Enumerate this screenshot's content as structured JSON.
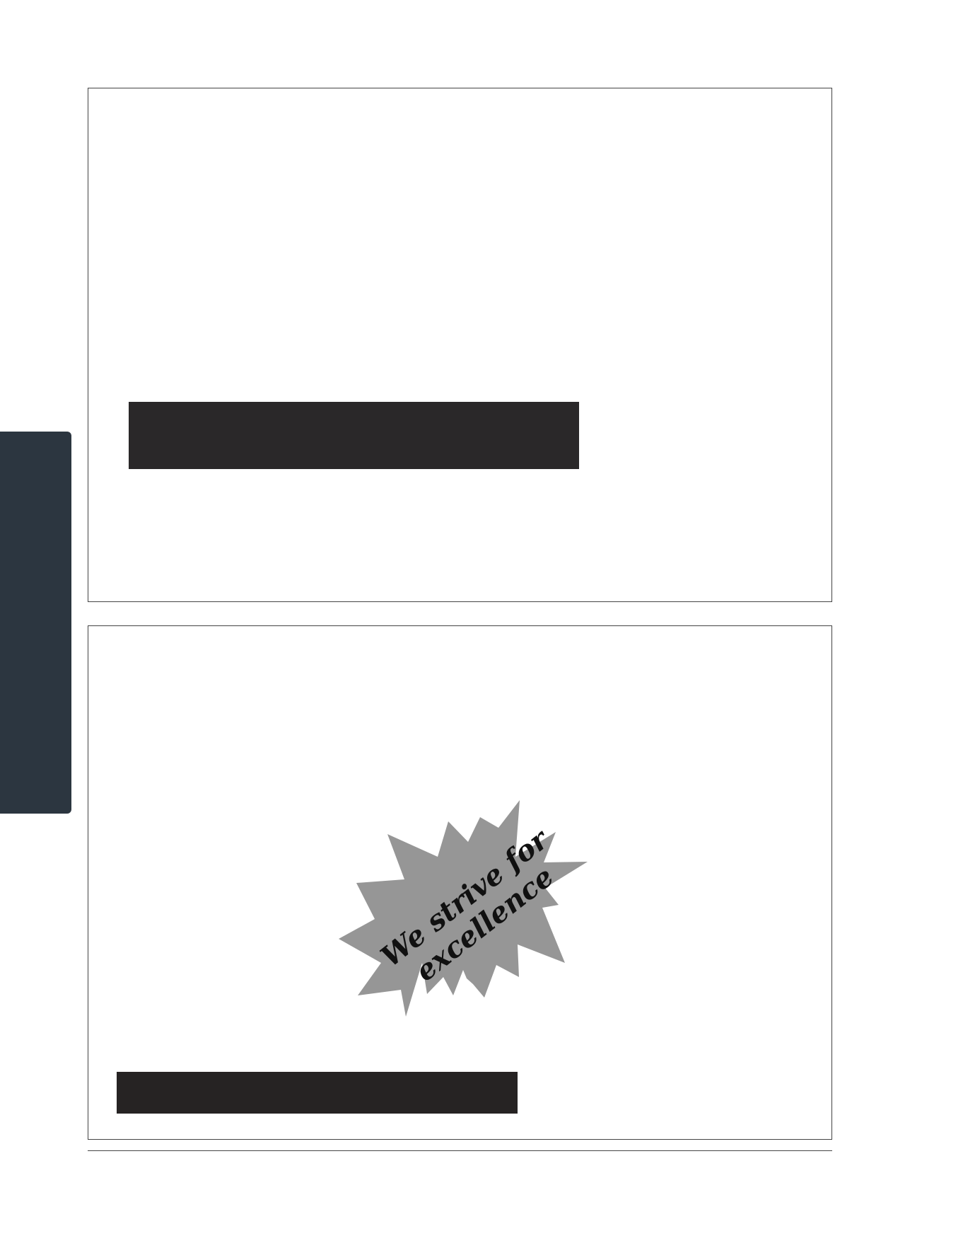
{
  "colors": {
    "side_tab": "#2c3640",
    "redaction_bar": "#2a2829",
    "starburst_fill": "#969696",
    "panel_border": "#444444"
  },
  "starburst": {
    "line1": "We strive for",
    "line2": "excellence"
  }
}
